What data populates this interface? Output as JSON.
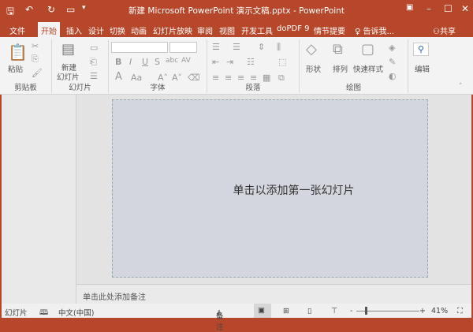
{
  "window": {
    "title": "新建 Microsoft PowerPoint 演示文稿.pptx - PowerPoint"
  },
  "tabs": [
    "文件",
    "开始",
    "插入",
    "设计",
    "切换",
    "动画",
    "幻灯片放映",
    "审阅",
    "视图",
    "开发工具",
    "doPDF 9",
    "情节提要"
  ],
  "active_tab": "开始",
  "tell_me": "告诉我...",
  "share": "共享",
  "ribbon": {
    "clipboard": {
      "label": "剪贴板",
      "paste": "粘贴"
    },
    "slides": {
      "label": "幻灯片",
      "new_slide_line1": "新建",
      "new_slide_line2": "幻灯片"
    },
    "font": {
      "label": "字体",
      "font_name": "",
      "font_size": ""
    },
    "paragraph": {
      "label": "段落"
    },
    "drawing": {
      "label": "绘图",
      "shapes": "形状",
      "arrange": "排列",
      "quick_styles": "快速样式"
    },
    "editing": {
      "label": "编辑"
    }
  },
  "slide": {
    "placeholder": "单击以添加第一张幻灯片"
  },
  "notes": {
    "placeholder": "单击此处添加备注"
  },
  "status": {
    "view": "幻灯片",
    "language": "中文(中国)",
    "notes": "备注",
    "zoom": "41%"
  },
  "colors": {
    "accent": "#b7472a",
    "slide_bg": "#d3d6de"
  }
}
